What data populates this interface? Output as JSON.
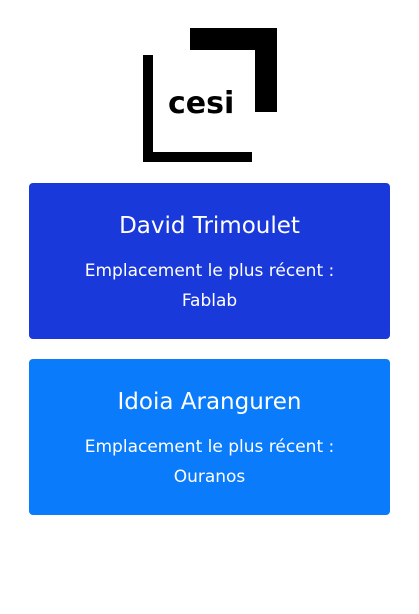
{
  "logo": {
    "text": "cesi",
    "icon": "cesi-logo"
  },
  "colors": {
    "card_1_bg": "#1a39db",
    "card_2_bg": "#0a7bfa",
    "text": "#ffffff",
    "logo": "#000000"
  },
  "cards": [
    {
      "name": "David Trimoulet",
      "label": "Emplacement le plus récent :",
      "location": "Fablab"
    },
    {
      "name": "Idoia Aranguren",
      "label": "Emplacement le plus récent :",
      "location": "Ouranos"
    }
  ]
}
